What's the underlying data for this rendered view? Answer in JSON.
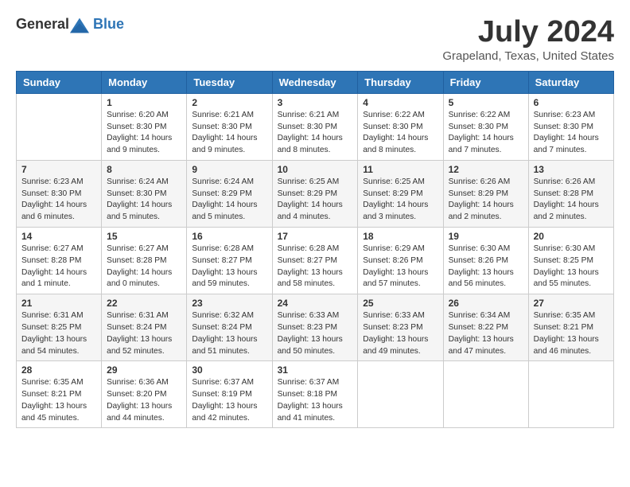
{
  "logo": {
    "general": "General",
    "blue": "Blue"
  },
  "title": "July 2024",
  "location": "Grapeland, Texas, United States",
  "headers": [
    "Sunday",
    "Monday",
    "Tuesday",
    "Wednesday",
    "Thursday",
    "Friday",
    "Saturday"
  ],
  "weeks": [
    [
      {
        "day": "",
        "info": ""
      },
      {
        "day": "1",
        "info": "Sunrise: 6:20 AM\nSunset: 8:30 PM\nDaylight: 14 hours\nand 9 minutes."
      },
      {
        "day": "2",
        "info": "Sunrise: 6:21 AM\nSunset: 8:30 PM\nDaylight: 14 hours\nand 9 minutes."
      },
      {
        "day": "3",
        "info": "Sunrise: 6:21 AM\nSunset: 8:30 PM\nDaylight: 14 hours\nand 8 minutes."
      },
      {
        "day": "4",
        "info": "Sunrise: 6:22 AM\nSunset: 8:30 PM\nDaylight: 14 hours\nand 8 minutes."
      },
      {
        "day": "5",
        "info": "Sunrise: 6:22 AM\nSunset: 8:30 PM\nDaylight: 14 hours\nand 7 minutes."
      },
      {
        "day": "6",
        "info": "Sunrise: 6:23 AM\nSunset: 8:30 PM\nDaylight: 14 hours\nand 7 minutes."
      }
    ],
    [
      {
        "day": "7",
        "info": "Sunrise: 6:23 AM\nSunset: 8:30 PM\nDaylight: 14 hours\nand 6 minutes."
      },
      {
        "day": "8",
        "info": "Sunrise: 6:24 AM\nSunset: 8:30 PM\nDaylight: 14 hours\nand 5 minutes."
      },
      {
        "day": "9",
        "info": "Sunrise: 6:24 AM\nSunset: 8:29 PM\nDaylight: 14 hours\nand 5 minutes."
      },
      {
        "day": "10",
        "info": "Sunrise: 6:25 AM\nSunset: 8:29 PM\nDaylight: 14 hours\nand 4 minutes."
      },
      {
        "day": "11",
        "info": "Sunrise: 6:25 AM\nSunset: 8:29 PM\nDaylight: 14 hours\nand 3 minutes."
      },
      {
        "day": "12",
        "info": "Sunrise: 6:26 AM\nSunset: 8:29 PM\nDaylight: 14 hours\nand 2 minutes."
      },
      {
        "day": "13",
        "info": "Sunrise: 6:26 AM\nSunset: 8:28 PM\nDaylight: 14 hours\nand 2 minutes."
      }
    ],
    [
      {
        "day": "14",
        "info": "Sunrise: 6:27 AM\nSunset: 8:28 PM\nDaylight: 14 hours\nand 1 minute."
      },
      {
        "day": "15",
        "info": "Sunrise: 6:27 AM\nSunset: 8:28 PM\nDaylight: 14 hours\nand 0 minutes."
      },
      {
        "day": "16",
        "info": "Sunrise: 6:28 AM\nSunset: 8:27 PM\nDaylight: 13 hours\nand 59 minutes."
      },
      {
        "day": "17",
        "info": "Sunrise: 6:28 AM\nSunset: 8:27 PM\nDaylight: 13 hours\nand 58 minutes."
      },
      {
        "day": "18",
        "info": "Sunrise: 6:29 AM\nSunset: 8:26 PM\nDaylight: 13 hours\nand 57 minutes."
      },
      {
        "day": "19",
        "info": "Sunrise: 6:30 AM\nSunset: 8:26 PM\nDaylight: 13 hours\nand 56 minutes."
      },
      {
        "day": "20",
        "info": "Sunrise: 6:30 AM\nSunset: 8:25 PM\nDaylight: 13 hours\nand 55 minutes."
      }
    ],
    [
      {
        "day": "21",
        "info": "Sunrise: 6:31 AM\nSunset: 8:25 PM\nDaylight: 13 hours\nand 54 minutes."
      },
      {
        "day": "22",
        "info": "Sunrise: 6:31 AM\nSunset: 8:24 PM\nDaylight: 13 hours\nand 52 minutes."
      },
      {
        "day": "23",
        "info": "Sunrise: 6:32 AM\nSunset: 8:24 PM\nDaylight: 13 hours\nand 51 minutes."
      },
      {
        "day": "24",
        "info": "Sunrise: 6:33 AM\nSunset: 8:23 PM\nDaylight: 13 hours\nand 50 minutes."
      },
      {
        "day": "25",
        "info": "Sunrise: 6:33 AM\nSunset: 8:23 PM\nDaylight: 13 hours\nand 49 minutes."
      },
      {
        "day": "26",
        "info": "Sunrise: 6:34 AM\nSunset: 8:22 PM\nDaylight: 13 hours\nand 47 minutes."
      },
      {
        "day": "27",
        "info": "Sunrise: 6:35 AM\nSunset: 8:21 PM\nDaylight: 13 hours\nand 46 minutes."
      }
    ],
    [
      {
        "day": "28",
        "info": "Sunrise: 6:35 AM\nSunset: 8:21 PM\nDaylight: 13 hours\nand 45 minutes."
      },
      {
        "day": "29",
        "info": "Sunrise: 6:36 AM\nSunset: 8:20 PM\nDaylight: 13 hours\nand 44 minutes."
      },
      {
        "day": "30",
        "info": "Sunrise: 6:37 AM\nSunset: 8:19 PM\nDaylight: 13 hours\nand 42 minutes."
      },
      {
        "day": "31",
        "info": "Sunrise: 6:37 AM\nSunset: 8:18 PM\nDaylight: 13 hours\nand 41 minutes."
      },
      {
        "day": "",
        "info": ""
      },
      {
        "day": "",
        "info": ""
      },
      {
        "day": "",
        "info": ""
      }
    ]
  ]
}
